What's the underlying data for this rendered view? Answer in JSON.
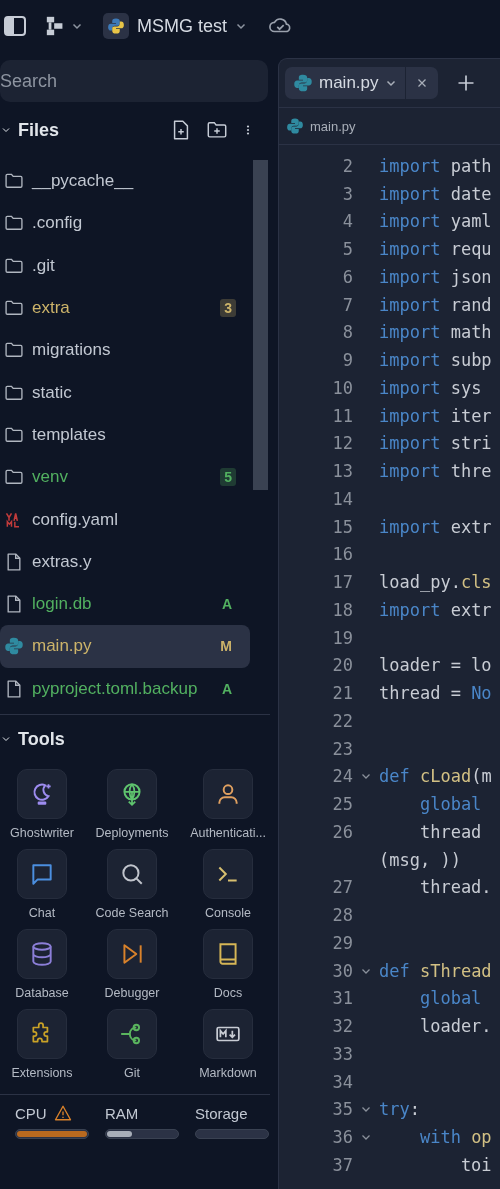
{
  "top_bar": {
    "project_name": "MSMG test"
  },
  "search": {
    "placeholder": "Search"
  },
  "files": {
    "title": "Files",
    "expanded": true,
    "items": [
      {
        "name": "__pycache__",
        "kind": "folder",
        "color": "#c2c8d2",
        "selected": false
      },
      {
        "name": ".config",
        "kind": "folder",
        "color": "#c2c8d2",
        "selected": false
      },
      {
        "name": ".git",
        "kind": "folder",
        "color": "#c2c8d2",
        "selected": false
      },
      {
        "name": "extra",
        "kind": "folder",
        "color": "#cdb46a",
        "selected": false,
        "badge": "3",
        "badge_boxed": true
      },
      {
        "name": "migrations",
        "kind": "folder",
        "color": "#c2c8d2",
        "selected": false
      },
      {
        "name": "static",
        "kind": "folder",
        "color": "#c2c8d2",
        "selected": false
      },
      {
        "name": "templates",
        "kind": "folder",
        "color": "#c2c8d2",
        "selected": false
      },
      {
        "name": "venv",
        "kind": "folder",
        "color": "#52b060",
        "selected": false,
        "badge": "5",
        "badge_boxed": true
      },
      {
        "name": "config.yaml",
        "kind": "yaml",
        "color": "#c2c8d2",
        "selected": false
      },
      {
        "name": "extras.y",
        "kind": "file",
        "color": "#c2c8d2",
        "selected": false
      },
      {
        "name": "login.db",
        "kind": "file",
        "color": "#52b060",
        "selected": false,
        "badge": "A",
        "badge_boxed": false
      },
      {
        "name": "main.py",
        "kind": "python",
        "color": "#cdb46a",
        "selected": true,
        "badge": "M",
        "badge_boxed": false
      },
      {
        "name": "pyproject.toml.backup",
        "kind": "file",
        "color": "#52b060",
        "selected": false,
        "badge": "A",
        "badge_boxed": false
      }
    ]
  },
  "tools": {
    "title": "Tools",
    "expanded": true,
    "items": [
      {
        "label": "Ghostwriter",
        "kind": "moon",
        "color": "#9d8cf0"
      },
      {
        "label": "Deployments",
        "kind": "globe",
        "color": "#5fc46e"
      },
      {
        "label": "Authenticati...",
        "kind": "person",
        "color": "#e0a060"
      },
      {
        "label": "Chat",
        "kind": "chat",
        "color": "#4b8fe0"
      },
      {
        "label": "Code Search",
        "kind": "search",
        "color": "#c0c4cc"
      },
      {
        "label": "Console",
        "kind": "terminal",
        "color": "#d8c070"
      },
      {
        "label": "Database",
        "kind": "database",
        "color": "#8c7fd8"
      },
      {
        "label": "Debugger",
        "kind": "debug",
        "color": "#d9822b"
      },
      {
        "label": "Docs",
        "kind": "book",
        "color": "#d6b656"
      },
      {
        "label": "Extensions",
        "kind": "puzzle",
        "color": "#c9a227"
      },
      {
        "label": "Git",
        "kind": "branch",
        "color": "#5ab55e"
      },
      {
        "label": "Markdown",
        "kind": "markdown",
        "color": "#c8ccd4"
      }
    ]
  },
  "resources": [
    {
      "label": "CPU",
      "warning": true,
      "level": 1
    },
    {
      "label": "RAM",
      "warning": false,
      "level": 0.35
    },
    {
      "label": "Storage",
      "warning": false,
      "level": 0
    }
  ],
  "editor": {
    "tabs": [
      {
        "label": "main.py",
        "selected": true
      }
    ],
    "breadcrumb": "main.py",
    "lines": [
      {
        "kind": "line",
        "number": "2",
        "fold": false,
        "tokens": [
          {
            "text": "import",
            "kind": "keyword"
          },
          {
            "text": " path",
            "kind": "plain"
          }
        ]
      },
      {
        "kind": "line",
        "number": "3",
        "fold": false,
        "tokens": [
          {
            "text": "import",
            "kind": "keyword"
          },
          {
            "text": " date",
            "kind": "plain"
          }
        ]
      },
      {
        "kind": "line",
        "number": "4",
        "fold": false,
        "tokens": [
          {
            "text": "import",
            "kind": "keyword"
          },
          {
            "text": " yaml",
            "kind": "plain"
          }
        ]
      },
      {
        "kind": "line",
        "number": "5",
        "fold": false,
        "tokens": [
          {
            "text": "import",
            "kind": "keyword"
          },
          {
            "text": " requ",
            "kind": "plain"
          }
        ]
      },
      {
        "kind": "line",
        "number": "6",
        "fold": false,
        "tokens": [
          {
            "text": "import",
            "kind": "keyword"
          },
          {
            "text": " json",
            "kind": "plain"
          }
        ]
      },
      {
        "kind": "line",
        "number": "7",
        "fold": false,
        "tokens": [
          {
            "text": "import",
            "kind": "keyword"
          },
          {
            "text": " rand",
            "kind": "plain"
          }
        ]
      },
      {
        "kind": "line",
        "number": "8",
        "fold": false,
        "tokens": [
          {
            "text": "import",
            "kind": "keyword"
          },
          {
            "text": " math",
            "kind": "plain"
          }
        ]
      },
      {
        "kind": "line",
        "number": "9",
        "fold": false,
        "tokens": [
          {
            "text": "import",
            "kind": "keyword"
          },
          {
            "text": " subp",
            "kind": "plain"
          }
        ]
      },
      {
        "kind": "line",
        "number": "10",
        "fold": false,
        "tokens": [
          {
            "text": "import",
            "kind": "keyword"
          },
          {
            "text": " sys",
            "kind": "plain"
          }
        ]
      },
      {
        "kind": "line",
        "number": "11",
        "fold": false,
        "tokens": [
          {
            "text": "import",
            "kind": "keyword"
          },
          {
            "text": " iter",
            "kind": "plain"
          }
        ]
      },
      {
        "kind": "line",
        "number": "12",
        "fold": false,
        "tokens": [
          {
            "text": "import",
            "kind": "keyword"
          },
          {
            "text": " stri",
            "kind": "plain"
          }
        ]
      },
      {
        "kind": "line",
        "number": "13",
        "fold": false,
        "tokens": [
          {
            "text": "import",
            "kind": "keyword"
          },
          {
            "text": " thre",
            "kind": "plain"
          }
        ]
      },
      {
        "kind": "line",
        "number": "14",
        "fold": false
      },
      {
        "kind": "line",
        "number": "15",
        "fold": false,
        "tokens": [
          {
            "text": "import",
            "kind": "keyword"
          },
          {
            "text": " extr",
            "kind": "plain"
          }
        ]
      },
      {
        "kind": "line",
        "number": "16",
        "fold": false
      },
      {
        "kind": "line",
        "number": "17",
        "fold": false,
        "tokens": [
          {
            "text": "load_py.",
            "kind": "plain"
          },
          {
            "text": "cls",
            "kind": "function"
          }
        ]
      },
      {
        "kind": "line",
        "number": "18",
        "fold": false,
        "tokens": [
          {
            "text": "import",
            "kind": "keyword"
          },
          {
            "text": " extr",
            "kind": "plain"
          }
        ]
      },
      {
        "kind": "line",
        "number": "19",
        "fold": false
      },
      {
        "kind": "line",
        "number": "20",
        "fold": false,
        "tokens": [
          {
            "text": "loader = lo",
            "kind": "plain"
          }
        ]
      },
      {
        "kind": "line",
        "number": "21",
        "fold": false,
        "tokens": [
          {
            "text": "thread = ",
            "kind": "plain"
          },
          {
            "text": "No",
            "kind": "keyword"
          }
        ]
      },
      {
        "kind": "line",
        "number": "22",
        "fold": false
      },
      {
        "kind": "line",
        "number": "23",
        "fold": false
      },
      {
        "kind": "line",
        "number": "24",
        "fold": true,
        "tokens": [
          {
            "text": "def",
            "kind": "keyword"
          },
          {
            "text": " cLoad",
            "kind": "function"
          },
          {
            "text": "(m",
            "kind": "plain"
          }
        ]
      },
      {
        "kind": "line",
        "number": "25",
        "fold": false,
        "tokens": [
          {
            "text": "    global",
            "kind": "keyword"
          }
        ]
      },
      {
        "kind": "line",
        "number": "26",
        "fold": false,
        "tokens": [
          {
            "text": "    thread",
            "kind": "plain"
          }
        ]
      },
      {
        "kind": "wrap",
        "tokens": [
          {
            "text": "(msg, ))",
            "kind": "plain"
          }
        ]
      },
      {
        "kind": "line",
        "number": "27",
        "fold": false,
        "tokens": [
          {
            "text": "    thread.",
            "kind": "plain"
          }
        ]
      },
      {
        "kind": "line",
        "number": "28",
        "fold": false
      },
      {
        "kind": "line",
        "number": "29",
        "fold": false
      },
      {
        "kind": "line",
        "number": "30",
        "fold": true,
        "tokens": [
          {
            "text": "def",
            "kind": "keyword"
          },
          {
            "text": " sThread",
            "kind": "function"
          }
        ]
      },
      {
        "kind": "line",
        "number": "31",
        "fold": false,
        "tokens": [
          {
            "text": "    global",
            "kind": "keyword"
          }
        ]
      },
      {
        "kind": "line",
        "number": "32",
        "fold": false,
        "tokens": [
          {
            "text": "    loader.",
            "kind": "plain"
          }
        ]
      },
      {
        "kind": "line",
        "number": "33",
        "fold": false
      },
      {
        "kind": "line",
        "number": "34",
        "fold": false
      },
      {
        "kind": "line",
        "number": "35",
        "fold": true,
        "tokens": [
          {
            "text": "try",
            "kind": "keyword"
          },
          {
            "text": ":",
            "kind": "plain"
          }
        ]
      },
      {
        "kind": "line",
        "number": "36",
        "fold": true,
        "tokens": [
          {
            "text": "    with",
            "kind": "keyword"
          },
          {
            "text": " op",
            "kind": "function"
          }
        ]
      },
      {
        "kind": "line",
        "number": "37",
        "fold": false,
        "tokens": [
          {
            "text": "        toi",
            "kind": "plain"
          }
        ]
      }
    ]
  }
}
